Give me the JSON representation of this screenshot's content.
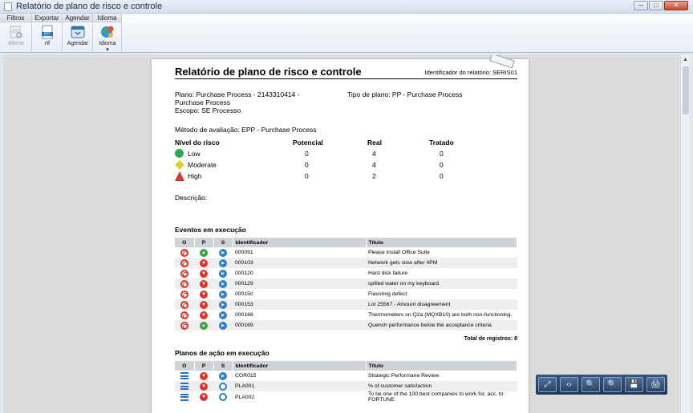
{
  "window": {
    "title": "Relatório de plano de risco e controle",
    "buttons": [
      "─",
      "□",
      "✕"
    ]
  },
  "ribbon": {
    "groups": [
      {
        "label": "Filtros",
        "buttons": [
          {
            "label": "Alterar",
            "icon": "edit-filter-icon",
            "disabled": true
          }
        ]
      },
      {
        "label": "Exportar",
        "buttons": [
          {
            "label": "rtf",
            "icon": "rtf-file-icon",
            "badge": "RTF"
          }
        ]
      },
      {
        "label": "Agendar",
        "buttons": [
          {
            "label": "Agendar",
            "icon": "calendar-icon"
          }
        ]
      },
      {
        "label": "Idioma",
        "buttons": [
          {
            "label": "Idioma",
            "icon": "globe-icon",
            "dropdown": "▾"
          }
        ]
      }
    ]
  },
  "report": {
    "title": "Relatório de plano de risco e controle",
    "identifier": "Identificador do relatório: SERIS01",
    "plan": "Plano: Purchase Process - 2143310414 - Purchase Process",
    "plan_type": "Tipo de plano: PP - Purchase Process",
    "scope": "Escopo: SE Processo",
    "method": "Método de avaliação: EPP - Purchase Process",
    "risk_headers": {
      "level": "Nível do risco",
      "potential": "Potencial",
      "real": "Real",
      "treated": "Tratado"
    },
    "risk_rows": [
      {
        "name": "Low",
        "potential": "0",
        "real": "4",
        "treated": "0",
        "color": "#2fa84f",
        "shape": "circle"
      },
      {
        "name": "Moderate",
        "potential": "0",
        "real": "4",
        "treated": "0",
        "color": "#d9d22c",
        "shape": "diamond"
      },
      {
        "name": "High",
        "potential": "0",
        "real": "2",
        "treated": "0",
        "color": "#d9362b",
        "shape": "triangle"
      }
    ],
    "description_label": "Descrição:",
    "events_title": "Eventos em execução",
    "table_headers": {
      "o": "O",
      "p": "P",
      "s": "S",
      "id": "Identificador",
      "title": "Título"
    },
    "events": [
      {
        "id": "000091",
        "title": "Please install Office Suite",
        "p": "up"
      },
      {
        "id": "000103",
        "title": "Network gets slow after 4PM",
        "p": "down"
      },
      {
        "id": "000120",
        "title": "Hard disk failure",
        "p": "down"
      },
      {
        "id": "000129",
        "title": "spilled water on my keyboard",
        "p": "down"
      },
      {
        "id": "000150",
        "title": "Flavoring defect",
        "p": "down"
      },
      {
        "id": "000153",
        "title": "Lot 25567 - Amount disagreement",
        "p": "down"
      },
      {
        "id": "000168",
        "title": "Thermometers on Q2a (MQXB10) are both non-functioning.",
        "p": "down"
      },
      {
        "id": "000169",
        "title": "Quench performance below the acceptance criteria",
        "p": "up"
      }
    ],
    "events_total": "Total de registros: 8",
    "plans_title": "Planos de ação em execução",
    "plans": [
      {
        "id": "COR015",
        "title": "Strategic Performane Review",
        "s": "play"
      },
      {
        "id": "PLA001",
        "title": "% of customer satisfaction",
        "s": "power"
      },
      {
        "id": "PLA002",
        "title": "To be one of the 100 best companies to work for, acc. to FORTUNE",
        "s": "power"
      }
    ]
  },
  "float_toolbar": [
    {
      "name": "fit-page-button",
      "glyph": "⤢"
    },
    {
      "name": "fit-width-button",
      "glyph": "‹›"
    },
    {
      "name": "zoom-out-button",
      "glyph": "🔍"
    },
    {
      "name": "zoom-in-button",
      "glyph": "🔍"
    },
    {
      "name": "save-button",
      "glyph": "💾"
    },
    {
      "name": "print-button",
      "glyph": "🖨"
    }
  ]
}
